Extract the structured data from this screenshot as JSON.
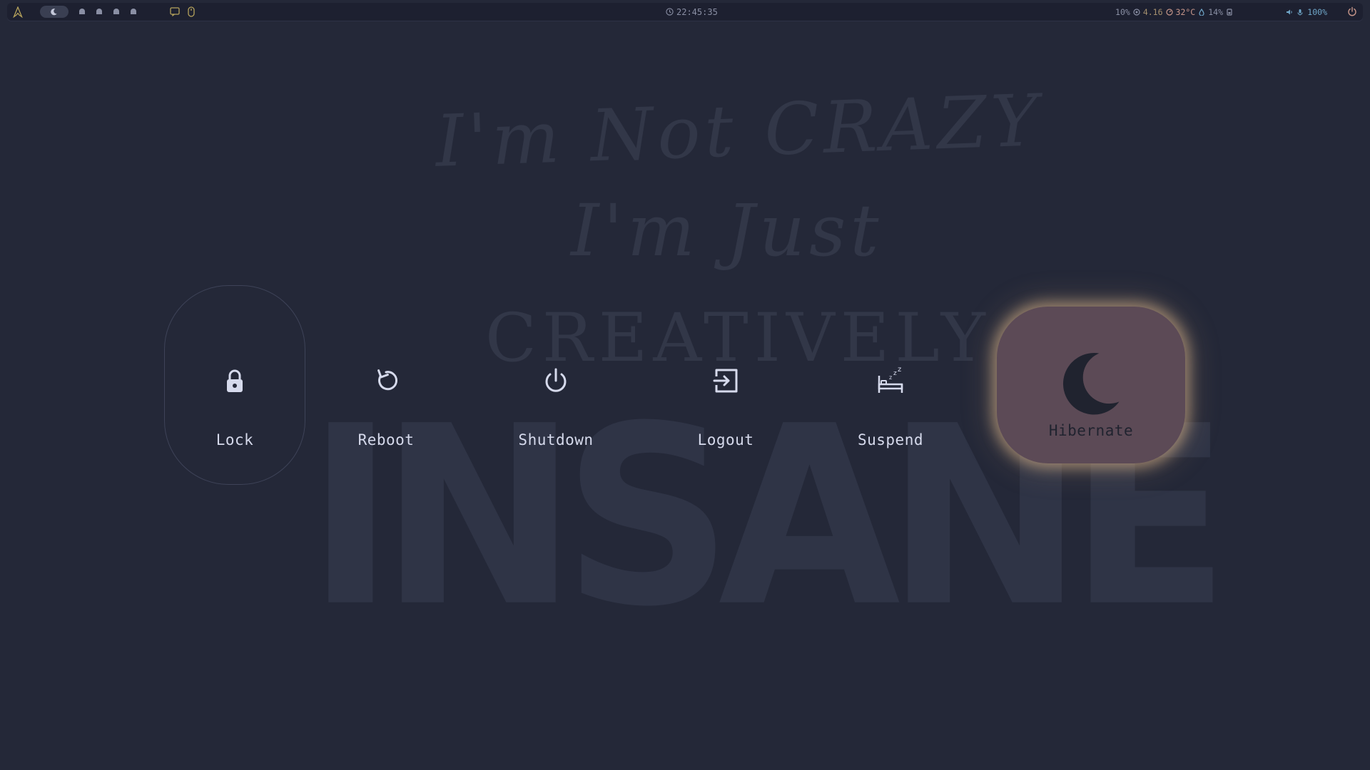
{
  "topbar": {
    "clock": "22:45:35",
    "cpu": "10%",
    "ram": "4.16",
    "temp": "32°C",
    "disk": "14%",
    "volume": "100%",
    "workspace_count": 5
  },
  "background": {
    "line1": "I'm Not CRAZY",
    "line2": "I'm Just",
    "line3": "CREATIVELY",
    "line4": "INSANE"
  },
  "actions": {
    "lock": "Lock",
    "reboot": "Reboot",
    "shutdown": "Shutdown",
    "logout": "Logout",
    "suspend": "Suspend",
    "hibernate": "Hibernate"
  },
  "colors": {
    "background": "#242838",
    "icon": "#d6daec",
    "hibernate_card": "#5c4a56",
    "hibernate_glow": "#deb88c",
    "accent_blue": "#6fa6c8"
  },
  "icons": {
    "lock": "lock-icon",
    "reboot": "reboot-icon",
    "shutdown": "power-icon",
    "logout": "logout-icon",
    "suspend": "bed-sleep-icon",
    "hibernate": "moon-icon"
  }
}
